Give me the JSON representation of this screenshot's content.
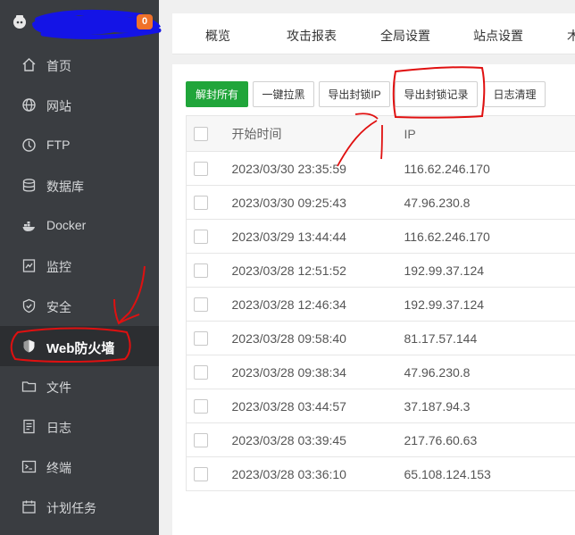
{
  "brand": {
    "badge_count": "0"
  },
  "sidebar": {
    "items": [
      {
        "label": "首页",
        "icon": "home-icon"
      },
      {
        "label": "网站",
        "icon": "globe-icon"
      },
      {
        "label": "FTP",
        "icon": "ftp-icon"
      },
      {
        "label": "数据库",
        "icon": "database-icon"
      },
      {
        "label": "Docker",
        "icon": "docker-icon"
      },
      {
        "label": "监控",
        "icon": "monitor-icon"
      },
      {
        "label": "安全",
        "icon": "shield-check-icon"
      },
      {
        "label": "Web防火墙",
        "icon": "firewall-shield-icon"
      },
      {
        "label": "文件",
        "icon": "folder-icon"
      },
      {
        "label": "日志",
        "icon": "log-icon"
      },
      {
        "label": "终端",
        "icon": "terminal-icon"
      },
      {
        "label": "计划任务",
        "icon": "calendar-icon"
      }
    ]
  },
  "tabs": [
    "概览",
    "攻击报表",
    "全局设置",
    "站点设置",
    "木"
  ],
  "toolbar": {
    "unban_all": "解封所有",
    "quick_block": "一键拉黑",
    "export_ip": "导出封锁IP",
    "export_records": "导出封锁记录",
    "clear_logs": "日志清理"
  },
  "table": {
    "headers": {
      "time": "开始时间",
      "ip": "IP"
    },
    "rows": [
      {
        "time": "2023/03/30 23:35:59",
        "ip": "116.62.246.170"
      },
      {
        "time": "2023/03/30 09:25:43",
        "ip": "47.96.230.8"
      },
      {
        "time": "2023/03/29 13:44:44",
        "ip": "116.62.246.170"
      },
      {
        "time": "2023/03/28 12:51:52",
        "ip": "192.99.37.124"
      },
      {
        "time": "2023/03/28 12:46:34",
        "ip": "192.99.37.124"
      },
      {
        "time": "2023/03/28 09:58:40",
        "ip": "81.17.57.144"
      },
      {
        "time": "2023/03/28 09:38:34",
        "ip": "47.96.230.8"
      },
      {
        "time": "2023/03/28 03:44:57",
        "ip": "37.187.94.3"
      },
      {
        "time": "2023/03/28 03:39:45",
        "ip": "217.76.60.63"
      },
      {
        "time": "2023/03/28 03:36:10",
        "ip": "65.108.124.153"
      }
    ]
  },
  "colors": {
    "sidebar_bg": "#3a3d41",
    "accent_green": "#20a53a",
    "badge_orange": "#f0712a",
    "annotation_red": "#e01010",
    "scribble_blue": "#1010e8"
  }
}
